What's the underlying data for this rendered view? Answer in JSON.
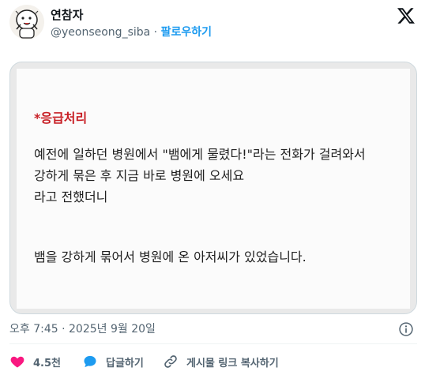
{
  "author": {
    "display_name": "연참자",
    "handle": "@yeonseong_siba",
    "separator": "·",
    "follow_label": "팔로우하기"
  },
  "media": {
    "heading": "*응급처리",
    "paragraph1": [
      "예전에 일하던 병원에서 \"뱀에게 물렸다!\"라는 전화가 걸려와서",
      "강하게 묶은 후 지금 바로 병원에 오세요",
      "라고 전했더니"
    ],
    "paragraph2": "뱀을 강하게 묶어서 병원에 온 아저씨가 있었습니다."
  },
  "meta": {
    "timestamp": "오후 7:45 · 2025년 9월 20일"
  },
  "actions": {
    "like_count": "4.5천",
    "reply_label": "답글하기",
    "copy_link_label": "게시물 링크 복사하기"
  },
  "colors": {
    "heart": "#f91880",
    "reply_bubble": "#1d9bf0",
    "follow": "#1d9bf0",
    "heading_red": "#c81f25"
  },
  "icons": [
    "x-logo-icon",
    "info-icon",
    "heart-icon",
    "reply-bubble-icon",
    "link-icon"
  ]
}
